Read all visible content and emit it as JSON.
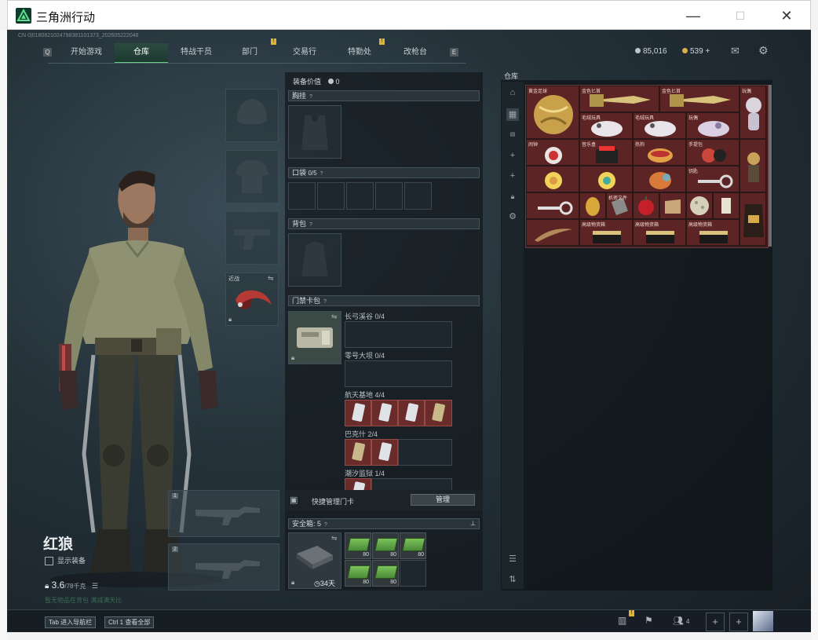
{
  "window": {
    "title": "三角洲行动",
    "minimize": "—",
    "maximize": "☐",
    "close": "✕"
  },
  "id_line": "CN 0|01808210247983811013​73_202605222048",
  "nav": {
    "key_left": "Q",
    "key_right": "E",
    "tabs": [
      {
        "label": "开始游戏",
        "selected": false,
        "alert": false
      },
      {
        "label": "仓库",
        "selected": true,
        "alert": false
      },
      {
        "label": "特战干员",
        "selected": false,
        "alert": false
      },
      {
        "label": "部门",
        "selected": false,
        "alert": true
      },
      {
        "label": "交易行",
        "selected": false,
        "alert": false
      },
      {
        "label": "特勤处",
        "selected": false,
        "alert": true
      },
      {
        "label": "改枪台",
        "selected": false,
        "alert": false
      }
    ],
    "alert_mark": "!"
  },
  "currency": {
    "silver": "85,016",
    "gold": "539 +"
  },
  "operator": {
    "name": "红狼",
    "show_equipment": "显示装备",
    "weight": "3.6",
    "weight_max": "/78千克",
    "hint": "暂无物品在背包 满减满天比"
  },
  "gear_slots": {
    "melee_label": "近战",
    "weapon1_label": "1",
    "weapon2_label": "2"
  },
  "equipment": {
    "value_label": "装备价值",
    "value": "0",
    "chest_rig": "胸挂",
    "pockets": "口袋",
    "pockets_count": "0/5",
    "backpack": "背包",
    "keycard_case": "门禁卡包",
    "q": "?",
    "keycards": [
      {
        "map": "长弓溪谷",
        "count": "0/4",
        "filled": 0
      },
      {
        "map": "零号大坝",
        "count": "0/4",
        "filled": 0
      },
      {
        "map": "航天基地",
        "count": "4/4",
        "filled": 4
      },
      {
        "map": "巴克什",
        "count": "2/4",
        "filled": 2
      },
      {
        "map": "潮汐监狱",
        "count": "1/4",
        "filled": 1
      }
    ],
    "quick_manage": "快捷管理门卡",
    "manage_button": "管理",
    "safebox": "安全箱",
    "safebox_count": "5",
    "safebox_days": "34天",
    "ammo_count": "80"
  },
  "warehouse": {
    "title": "仓库",
    "items_labels": [
      "黄金足球",
      "金色匕首",
      "金色匕首",
      "玩偶",
      "毛绒玩具",
      "毛绒玩具",
      "玩偶",
      "闹钟",
      "音乐盒",
      "热狗",
      "手提包",
      "钥匙",
      "机密文件",
      "金蛋",
      "苹果",
      "化石",
      "高级物资箱"
    ]
  },
  "bottom": {
    "tab_key": "Tab",
    "tab_label": "进入导航栏",
    "ctrl_key": "Ctrl 1",
    "ctrl_label": "查看全部",
    "squad_count": "4"
  }
}
